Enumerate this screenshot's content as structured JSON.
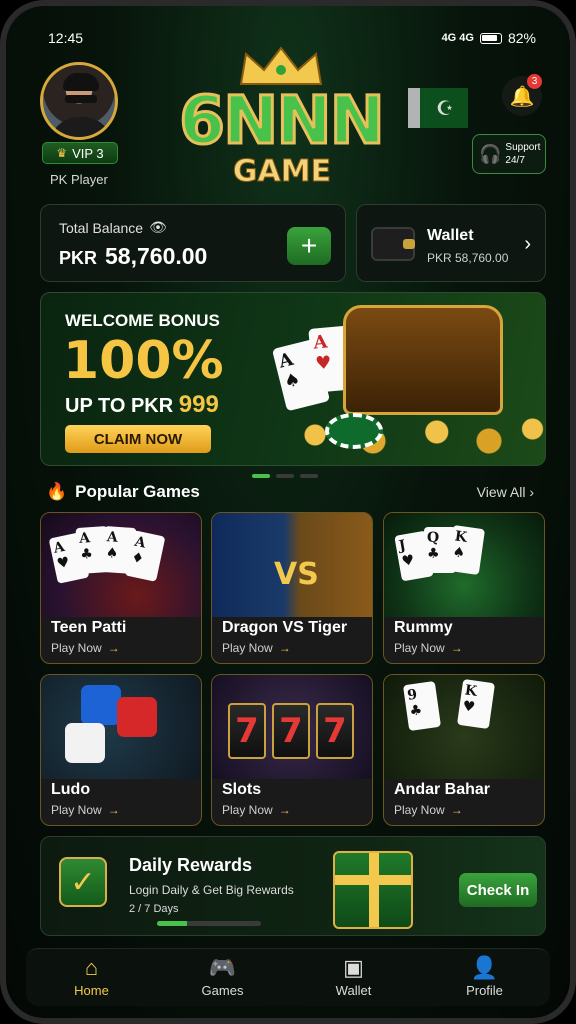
{
  "status_bar": {
    "time": "12:45",
    "network": "4G 4G",
    "battery": "82%"
  },
  "header": {
    "vip_label": "VIP 3",
    "player_name": "PK Player",
    "logo_main": "6NNN",
    "logo_sub": "GAME",
    "notification_count": "3",
    "support_line1": "Support",
    "support_line2": "24/7"
  },
  "balance": {
    "label": "Total Balance",
    "currency": "PKR",
    "amount": "58,760.00",
    "add_label": "+"
  },
  "wallet": {
    "title": "Wallet",
    "value": "PKR 58,760.00"
  },
  "banner": {
    "title": "WELCOME BONUS",
    "percent": "100%",
    "upto_prefix": "UP TO PKR",
    "upto_amount": "999",
    "cta": "CLAIM NOW"
  },
  "popular": {
    "title": "Popular Games",
    "view_all": "View All",
    "games": [
      {
        "name": "Teen Patti",
        "cta": "Play Now"
      },
      {
        "name": "Dragon VS Tiger",
        "cta": "Play Now"
      },
      {
        "name": "Rummy",
        "cta": "Play Now"
      },
      {
        "name": "Ludo",
        "cta": "Play Now"
      },
      {
        "name": "Slots",
        "cta": "Play Now"
      },
      {
        "name": "Andar Bahar",
        "cta": "Play Now"
      }
    ]
  },
  "rewards": {
    "title": "Daily Rewards",
    "subtitle": "Login Daily & Get Big Rewards",
    "days": "2 / 7 Days",
    "progress": 0.2857,
    "cta": "Check In"
  },
  "nav": {
    "items": [
      {
        "label": "Home",
        "icon": "home-icon",
        "active": true
      },
      {
        "label": "Games",
        "icon": "gamepad-icon",
        "active": false
      },
      {
        "label": "Wallet",
        "icon": "wallet-icon",
        "active": false
      },
      {
        "label": "Profile",
        "icon": "profile-icon",
        "active": false
      }
    ]
  },
  "colors": {
    "accent_gold": "#f2c94c",
    "accent_green": "#48c24a",
    "alert_red": "#e53935"
  }
}
